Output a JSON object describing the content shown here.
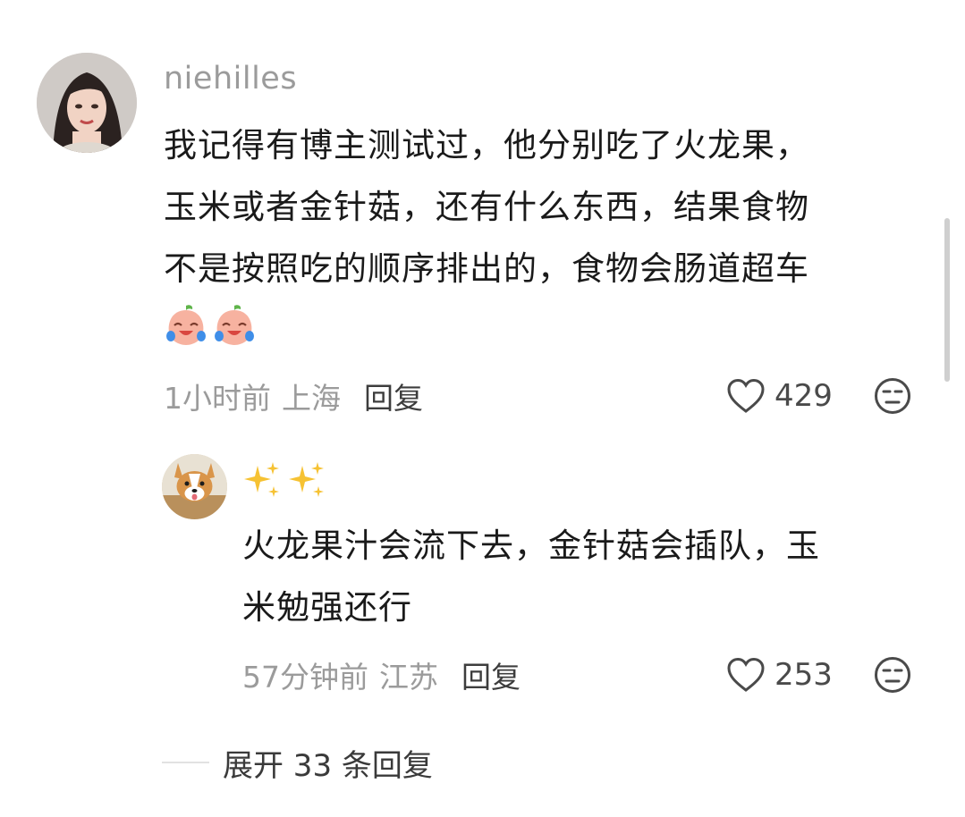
{
  "comment": {
    "username": "niehilles",
    "text_lines": [
      "我记得有博主测试过，他分别吃了火龙果，",
      "玉米或者金针菇，还有什么东西，结果食物",
      "不是按照吃的顺序排出的，食物会肠道超车"
    ],
    "emojis": [
      "crying-laughing-peach-emoji",
      "crying-laughing-peach-emoji"
    ],
    "time": "1小时前",
    "location": "上海",
    "reply_label": "回复",
    "like_count": "429",
    "avatar_icon": "woman-portrait-avatar"
  },
  "reply": {
    "username_icons": [
      "sparkles-emoji",
      "sparkles-emoji"
    ],
    "text_lines": [
      "火龙果汁会流下去，金针菇会插队，玉",
      "米勉强还行"
    ],
    "time": "57分钟前",
    "location": "江苏",
    "reply_label": "回复",
    "like_count": "253",
    "avatar_icon": "corgi-dog-avatar"
  },
  "expand": {
    "label": "展开 33 条回复"
  },
  "colors": {
    "text_primary": "#1a1a1a",
    "text_secondary": "#9b9b9b",
    "action_text": "#3d3d3d",
    "emoji_sparkle": "#f6c233",
    "emoji_peach": "#f7b2a0"
  }
}
